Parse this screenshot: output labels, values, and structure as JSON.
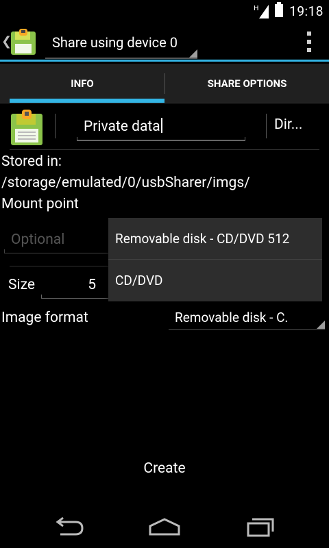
{
  "status_bar": {
    "time": "19:18",
    "signal": "H"
  },
  "action_bar": {
    "title": "Share using device 0",
    "accent_color": "#33b5e5"
  },
  "tabs": [
    {
      "label": "INFO",
      "selected": true
    },
    {
      "label": "SHARE OPTIONS",
      "selected": false
    }
  ],
  "form": {
    "name_value": "Private data",
    "dir_button": "Dir...",
    "stored_in_label": "Stored in:",
    "stored_in_path": "/storage/emulated/0/usbSharer/imgs/",
    "mount_point_label": "Mount point",
    "mount_point_placeholder": "Optional",
    "size_label": "Size",
    "size_value": "5",
    "image_format_label": "Image format",
    "image_format_value": "Removable disk - C."
  },
  "dropdown": {
    "options": [
      "Removable disk - CD/DVD 512",
      "CD/DVD"
    ]
  },
  "create_button": "Create",
  "navbar": {
    "icons": [
      "back-icon",
      "home-icon",
      "recents-icon"
    ]
  }
}
